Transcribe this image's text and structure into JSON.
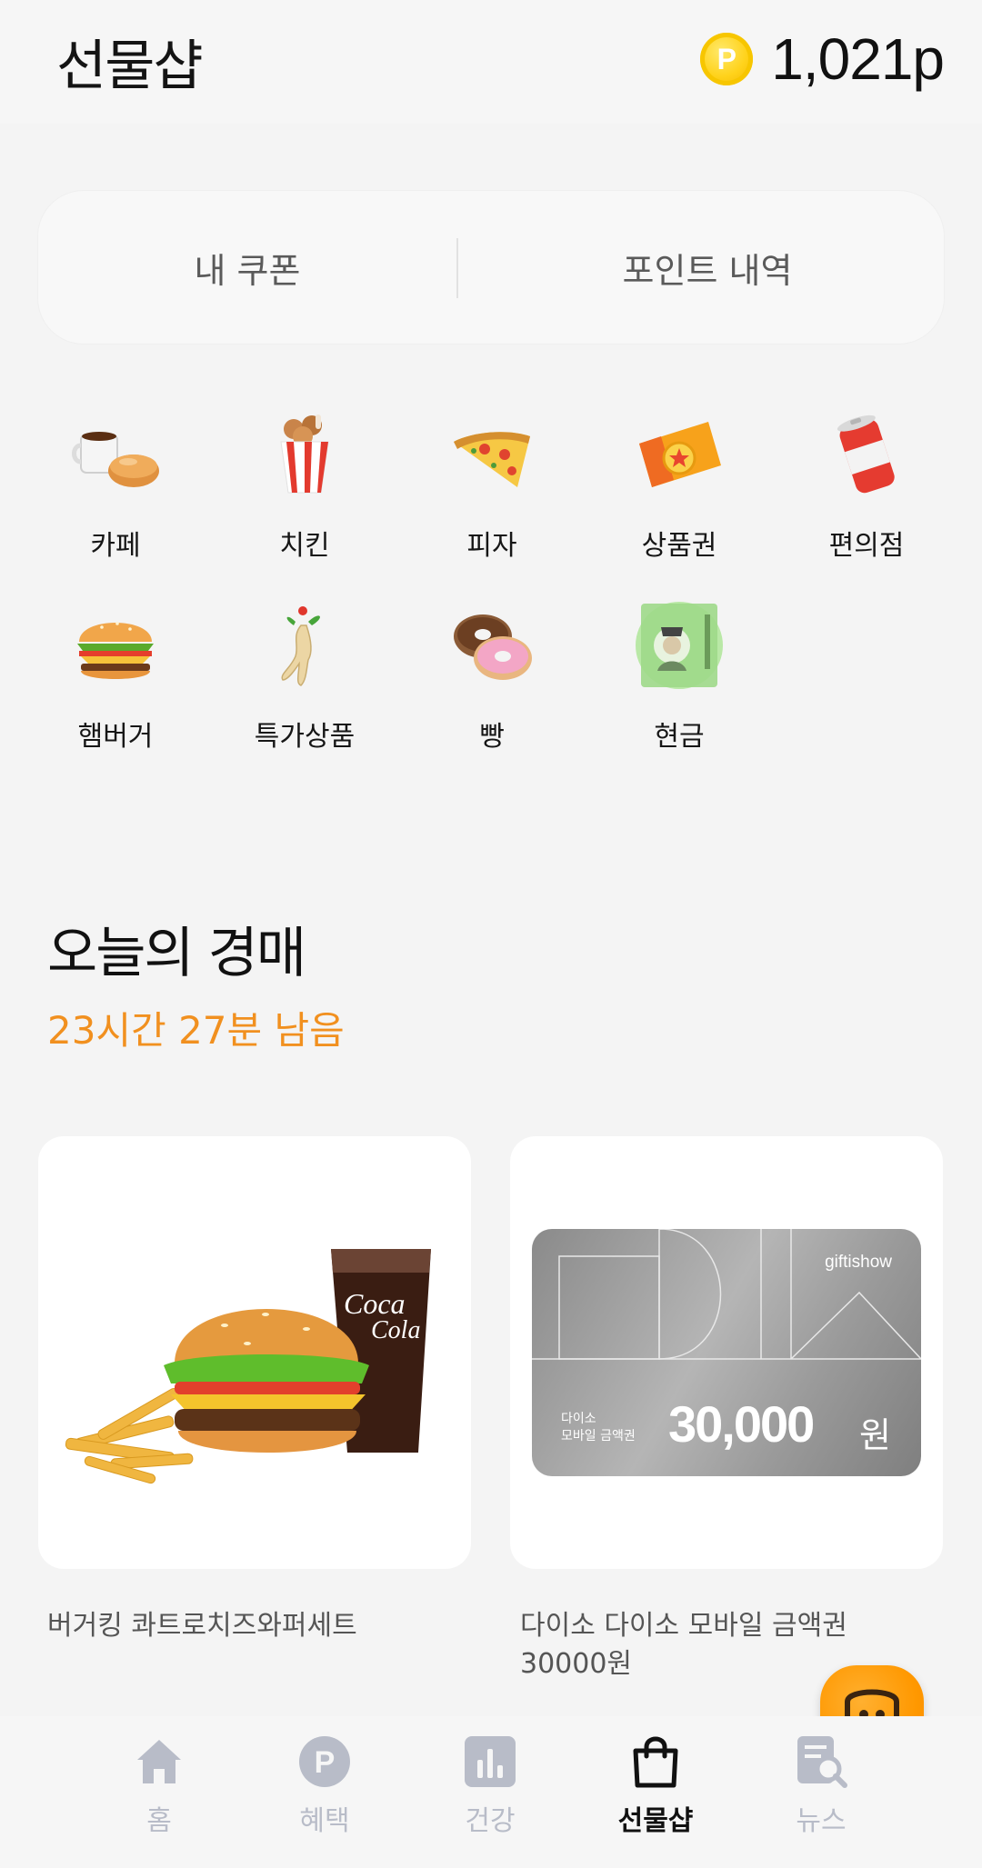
{
  "header": {
    "title": "선물샵",
    "coin_glyph": "P",
    "points": "1,021p"
  },
  "tabs": {
    "my_coupons": "내 쿠폰",
    "point_history": "포인트 내역"
  },
  "categories": [
    {
      "label": "카페",
      "icon": "coffee-bread-icon"
    },
    {
      "label": "치킨",
      "icon": "chicken-bucket-icon"
    },
    {
      "label": "피자",
      "icon": "pizza-slice-icon"
    },
    {
      "label": "상품권",
      "icon": "gift-ticket-icon"
    },
    {
      "label": "편의점",
      "icon": "soda-can-icon"
    },
    {
      "label": "햄버거",
      "icon": "hamburger-icon"
    },
    {
      "label": "특가상품",
      "icon": "ginseng-icon"
    },
    {
      "label": "빵",
      "icon": "donut-icon"
    },
    {
      "label": "현금",
      "icon": "banknote-icon"
    }
  ],
  "auction": {
    "title": "오늘의 경매",
    "timer": "23시간 27분 남음"
  },
  "products": [
    {
      "name": "버거킹 콰트로치즈와퍼세트",
      "discount": "",
      "price": ""
    },
    {
      "name_line1": "다이소 다이소 모바일 금액권",
      "name_line2": "30000원",
      "card_brand": "giftishow",
      "card_label_line1": "다이소",
      "card_label_line2": "모바일 금액권",
      "card_amount": "30,000",
      "card_unit": "원"
    }
  ],
  "nav": [
    {
      "label": "홈",
      "icon": "home-icon"
    },
    {
      "label": "혜택",
      "icon": "points-icon"
    },
    {
      "label": "건강",
      "icon": "chart-icon"
    },
    {
      "label": "선물샵",
      "icon": "shopping-bag-icon",
      "active": true
    },
    {
      "label": "뉴스",
      "icon": "news-search-icon"
    }
  ],
  "colors": {
    "accent_orange": "#f1901f",
    "discount_pink": "#e64a7a",
    "nav_inactive": "#b8bcc8"
  }
}
